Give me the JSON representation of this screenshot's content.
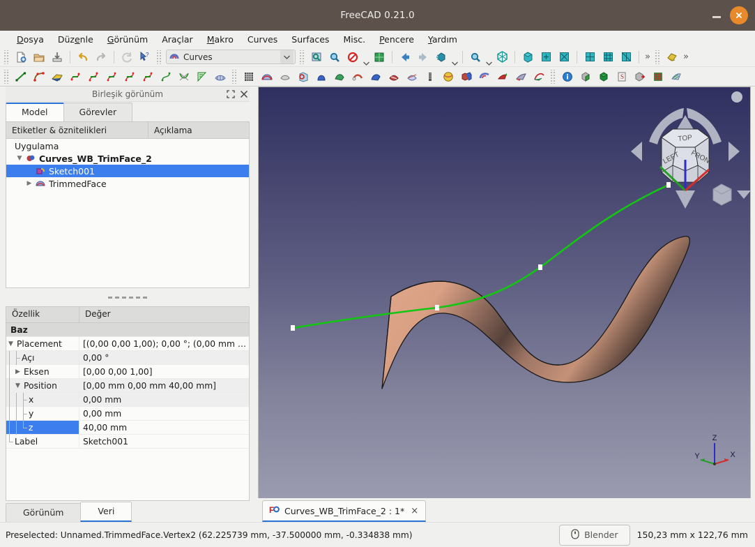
{
  "window": {
    "title": "FreeCAD 0.21.0",
    "minimize_label": "minimize",
    "close_label": "close"
  },
  "menubar": {
    "items": [
      {
        "label": "Dosya",
        "accel": "D"
      },
      {
        "label": "Düzenle",
        "accel": "e"
      },
      {
        "label": "Görünüm",
        "accel": "G"
      },
      {
        "label": "Araçlar",
        "accel": ""
      },
      {
        "label": "Makro",
        "accel": "M"
      },
      {
        "label": "Curves",
        "accel": ""
      },
      {
        "label": "Surfaces",
        "accel": ""
      },
      {
        "label": "Misc.",
        "accel": ""
      },
      {
        "label": "Pencere",
        "accel": "P"
      },
      {
        "label": "Yardım",
        "accel": "Y"
      }
    ]
  },
  "toolbar": {
    "workbench_selector": {
      "value": "Curves",
      "icon": "curves-workbench-icon"
    },
    "overflow_label": "»",
    "file_buttons": [
      "new-document-icon",
      "open-document-icon",
      "save-document-icon"
    ],
    "edit_buttons": [
      "undo-icon",
      "redo-icon",
      "refresh-icon",
      "whats-this-icon"
    ],
    "view_buttons": [
      "fit-all-icon",
      "fit-selection-icon",
      "draw-style-icon",
      "box-zoom-icon"
    ],
    "nav_buttons": [
      "previous-view-icon",
      "next-view-icon",
      "std-views-icon",
      "zoom-icon",
      "axonometric-icon",
      "front-view-icon",
      "top-view-icon",
      "right-view-icon",
      "rear-view-icon",
      "bottom-view-icon",
      "left-view-icon"
    ],
    "curves_buttons": [
      "line-icon",
      "bspline-icon",
      "editable-spline-icon",
      "join-curve-icon",
      "discretize-icon",
      "approximate-icon",
      "interpolate-icon",
      "parametric-blend-icon",
      "blend-curve-icon",
      "comb-plot-icon",
      "zebra-icon",
      "gordon-surface-icon"
    ],
    "surfaces_buttons": [
      "iso-curve-icon",
      "sketch-on-surface-icon",
      "pipeshell-icon",
      "trim-face-icon",
      "flatten-face-icon",
      "sublink-icon",
      "profile-support-icon",
      "sweep2rails-icon",
      "hooks-icon",
      "multi-loft-icon",
      "segment-surface-icon",
      "nurbs-surface-icon",
      "map-on-face-icon",
      "splitter-icon",
      "paste-icon",
      "extract-icon"
    ],
    "misc_buttons": [
      "info-icon",
      "box-element-icon",
      "solid-box-icon",
      "clipboard-icon",
      "export-icon",
      "grid-icon",
      "mesh-icon"
    ]
  },
  "combo_view": {
    "title": "Birleşik görünüm",
    "undock_icon": "undock-icon",
    "close_icon": "close-icon",
    "tabs": [
      {
        "label": "Model",
        "active": true
      },
      {
        "label": "Görevler",
        "active": false
      }
    ],
    "tree": {
      "columns": [
        "Etiketler & öznitelikleri",
        "Açıklama"
      ],
      "root_label": "Uygulama",
      "nodes": [
        {
          "label": "Curves_WB_TrimFace_2",
          "icon": "document-icon",
          "depth": 1,
          "bold": true,
          "expanded": true,
          "selected": false
        },
        {
          "label": "Sketch001",
          "icon": "sketch-icon",
          "depth": 2,
          "bold": false,
          "expanded": false,
          "selected": true
        },
        {
          "label": "TrimmedFace",
          "icon": "trimmed-face-icon",
          "depth": 2,
          "bold": false,
          "expanded": false,
          "selected": false
        }
      ]
    },
    "properties": {
      "columns": [
        "Özellik",
        "Değer"
      ],
      "rows": [
        {
          "key": "Baz",
          "value": "",
          "type": "group"
        },
        {
          "key": "Placement",
          "value": "[(0,00 0,00 1,00); 0,00 °; (0,00 mm  …",
          "type": "expandable-open",
          "depth": 0
        },
        {
          "key": "Açı",
          "value": "0,00 °",
          "type": "child",
          "depth": 1
        },
        {
          "key": "Eksen",
          "value": "[0,00 0,00 1,00]",
          "type": "expandable-closed",
          "depth": 1
        },
        {
          "key": "Position",
          "value": "[0,00 mm  0,00 mm  40,00 mm]",
          "type": "expandable-open",
          "depth": 1
        },
        {
          "key": "x",
          "value": "0,00 mm",
          "type": "child",
          "depth": 2
        },
        {
          "key": "y",
          "value": "0,00 mm",
          "type": "child",
          "depth": 2
        },
        {
          "key": "z",
          "value": "40,00 mm",
          "type": "child-selected",
          "depth": 2
        },
        {
          "key": "Label",
          "value": "Sketch001",
          "type": "leaf",
          "depth": 0
        }
      ]
    },
    "bottom_tabs": [
      {
        "label": "Görünüm",
        "active": false
      },
      {
        "label": "Veri",
        "active": true
      }
    ]
  },
  "viewport": {
    "document_tab": {
      "label": "Curves_WB_TrimFace_2 : 1*",
      "icon": "freecad-doc-icon",
      "close_label": "×"
    },
    "nav_cube": {
      "faces": [
        "TOP",
        "LEFT",
        "FRONT"
      ],
      "arrows": [
        "rotate-left-arrow",
        "rotate-right-arrow",
        "up-arrow",
        "down-arrow",
        "left-arrow",
        "right-arrow"
      ],
      "corner_dot": "view-menu-dot",
      "mini_cube": "view-preset-cube"
    },
    "axis_indicator": {
      "x_label": "X",
      "y_label": "Y",
      "z_label": "Z",
      "x_color": "#d22d2d",
      "y_color": "#23a023",
      "z_color": "#2d2dc8"
    },
    "objects": {
      "curve_label": "Sketch001 bspline",
      "curve_color": "#12c612",
      "control_point_color": "#ffffff",
      "control_point_count": 4,
      "surface_label": "TrimmedFace",
      "surface_color": "#d79e82",
      "edge_color": "#1a1a1a"
    },
    "background": {
      "top_color": "#2f3060",
      "bottom_color": "#9a9ab0"
    }
  },
  "statusbar": {
    "message": "Preselected: Unnamed.TrimmedFace.Vertex2 (62.225739 mm, -37.500000 mm, -0.334838 mm)",
    "nav_style_button": {
      "label": "Blender",
      "icon": "mouse-icon"
    },
    "dimensions": "150,23 mm x 122,76 mm"
  }
}
